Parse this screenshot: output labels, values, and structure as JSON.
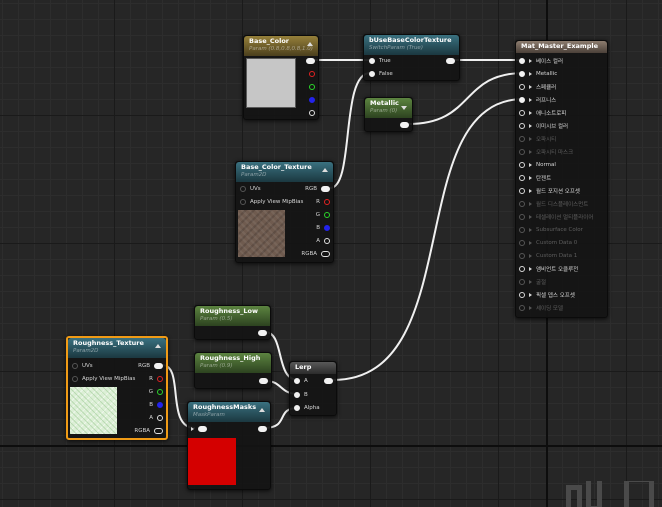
{
  "colors": {
    "canvas_bg": "#262626",
    "wire": "#f0f0f0",
    "selected_outline": "#f09b16",
    "vector_header": "#7d6a2f",
    "texture_header": "#2b5b68",
    "scalar_header": "#4c7035",
    "lerp_header": "#4a4a4a",
    "material_header": "#7a6c60",
    "base_color_swatch": "#c6c6c6",
    "roughness_mask_swatch": "#d40000",
    "pin_red": "#e32222",
    "pin_green": "#2ad62a",
    "pin_blue": "#2323ec"
  },
  "nodes": {
    "base_color": {
      "title": "Base_Color",
      "subtitle": "Param (0.8,0.8,0.8,1.0)",
      "pins": [
        "",
        "",
        "",
        "",
        ""
      ]
    },
    "switch": {
      "title": "bUseBaseColorTexture",
      "subtitle": "SwitchParam (True)",
      "pin_true": "True",
      "pin_false": "False"
    },
    "metallic": {
      "title": "Metallic",
      "subtitle": "Param (0)"
    },
    "base_color_texture": {
      "title": "Base_Color_Texture",
      "subtitle": "Param2D",
      "in_uvs": "UVs",
      "in_mip": "Apply View MipBias",
      "out_rgb": "RGB",
      "out_r": "R",
      "out_g": "G",
      "out_b": "B",
      "out_a": "A",
      "out_rgba": "RGBA"
    },
    "material": {
      "title": "Mat_Master_Example",
      "pins": [
        {
          "label": "베이스 컬러",
          "connected": true,
          "enabled": true
        },
        {
          "label": "Metallic",
          "connected": true,
          "enabled": true
        },
        {
          "label": "스페큘러",
          "connected": false,
          "enabled": true
        },
        {
          "label": "러프니스",
          "connected": true,
          "enabled": true
        },
        {
          "label": "애니소트로피",
          "connected": false,
          "enabled": true
        },
        {
          "label": "이미시브 컬러",
          "connected": false,
          "enabled": true
        },
        {
          "label": "오파시티",
          "connected": false,
          "enabled": false
        },
        {
          "label": "오파시티 마스크",
          "connected": false,
          "enabled": false
        },
        {
          "label": "Normal",
          "connected": false,
          "enabled": true
        },
        {
          "label": "탄젠트",
          "connected": false,
          "enabled": true
        },
        {
          "label": "월드 포지션 오프셋",
          "connected": false,
          "enabled": true
        },
        {
          "label": "월드 디스플레이스먼트",
          "connected": false,
          "enabled": false
        },
        {
          "label": "테셀레이션 멀티플라이어",
          "connected": false,
          "enabled": false
        },
        {
          "label": "Subsurface Color",
          "connected": false,
          "enabled": false
        },
        {
          "label": "Custom Data 0",
          "connected": false,
          "enabled": false
        },
        {
          "label": "Custom Data 1",
          "connected": false,
          "enabled": false
        },
        {
          "label": "앰비언트 오클루전",
          "connected": false,
          "enabled": true
        },
        {
          "label": "굴절",
          "connected": false,
          "enabled": false
        },
        {
          "label": "픽셀 뎁스 오프셋",
          "connected": false,
          "enabled": true
        },
        {
          "label": "셰이딩 모델",
          "connected": false,
          "enabled": false
        }
      ]
    },
    "roughness_low": {
      "title": "Roughness_Low",
      "subtitle": "Param (0.5)"
    },
    "roughness_high": {
      "title": "Roughness_High",
      "subtitle": "Param (0.9)"
    },
    "lerp": {
      "title": "Lerp",
      "in_a": "A",
      "in_b": "B",
      "in_alpha": "Alpha"
    },
    "roughness_texture": {
      "title": "Roughness_Texture",
      "subtitle": "Param2D",
      "in_uvs": "UVs",
      "in_mip": "Apply View MipBias",
      "out_rgb": "RGB",
      "out_r": "R",
      "out_g": "G",
      "out_b": "B",
      "out_a": "A",
      "out_rgba": "RGBA"
    },
    "roughness_masks": {
      "title": "RoughnessMasks",
      "subtitle": "MaskParam"
    }
  },
  "watermark_text": "머티"
}
